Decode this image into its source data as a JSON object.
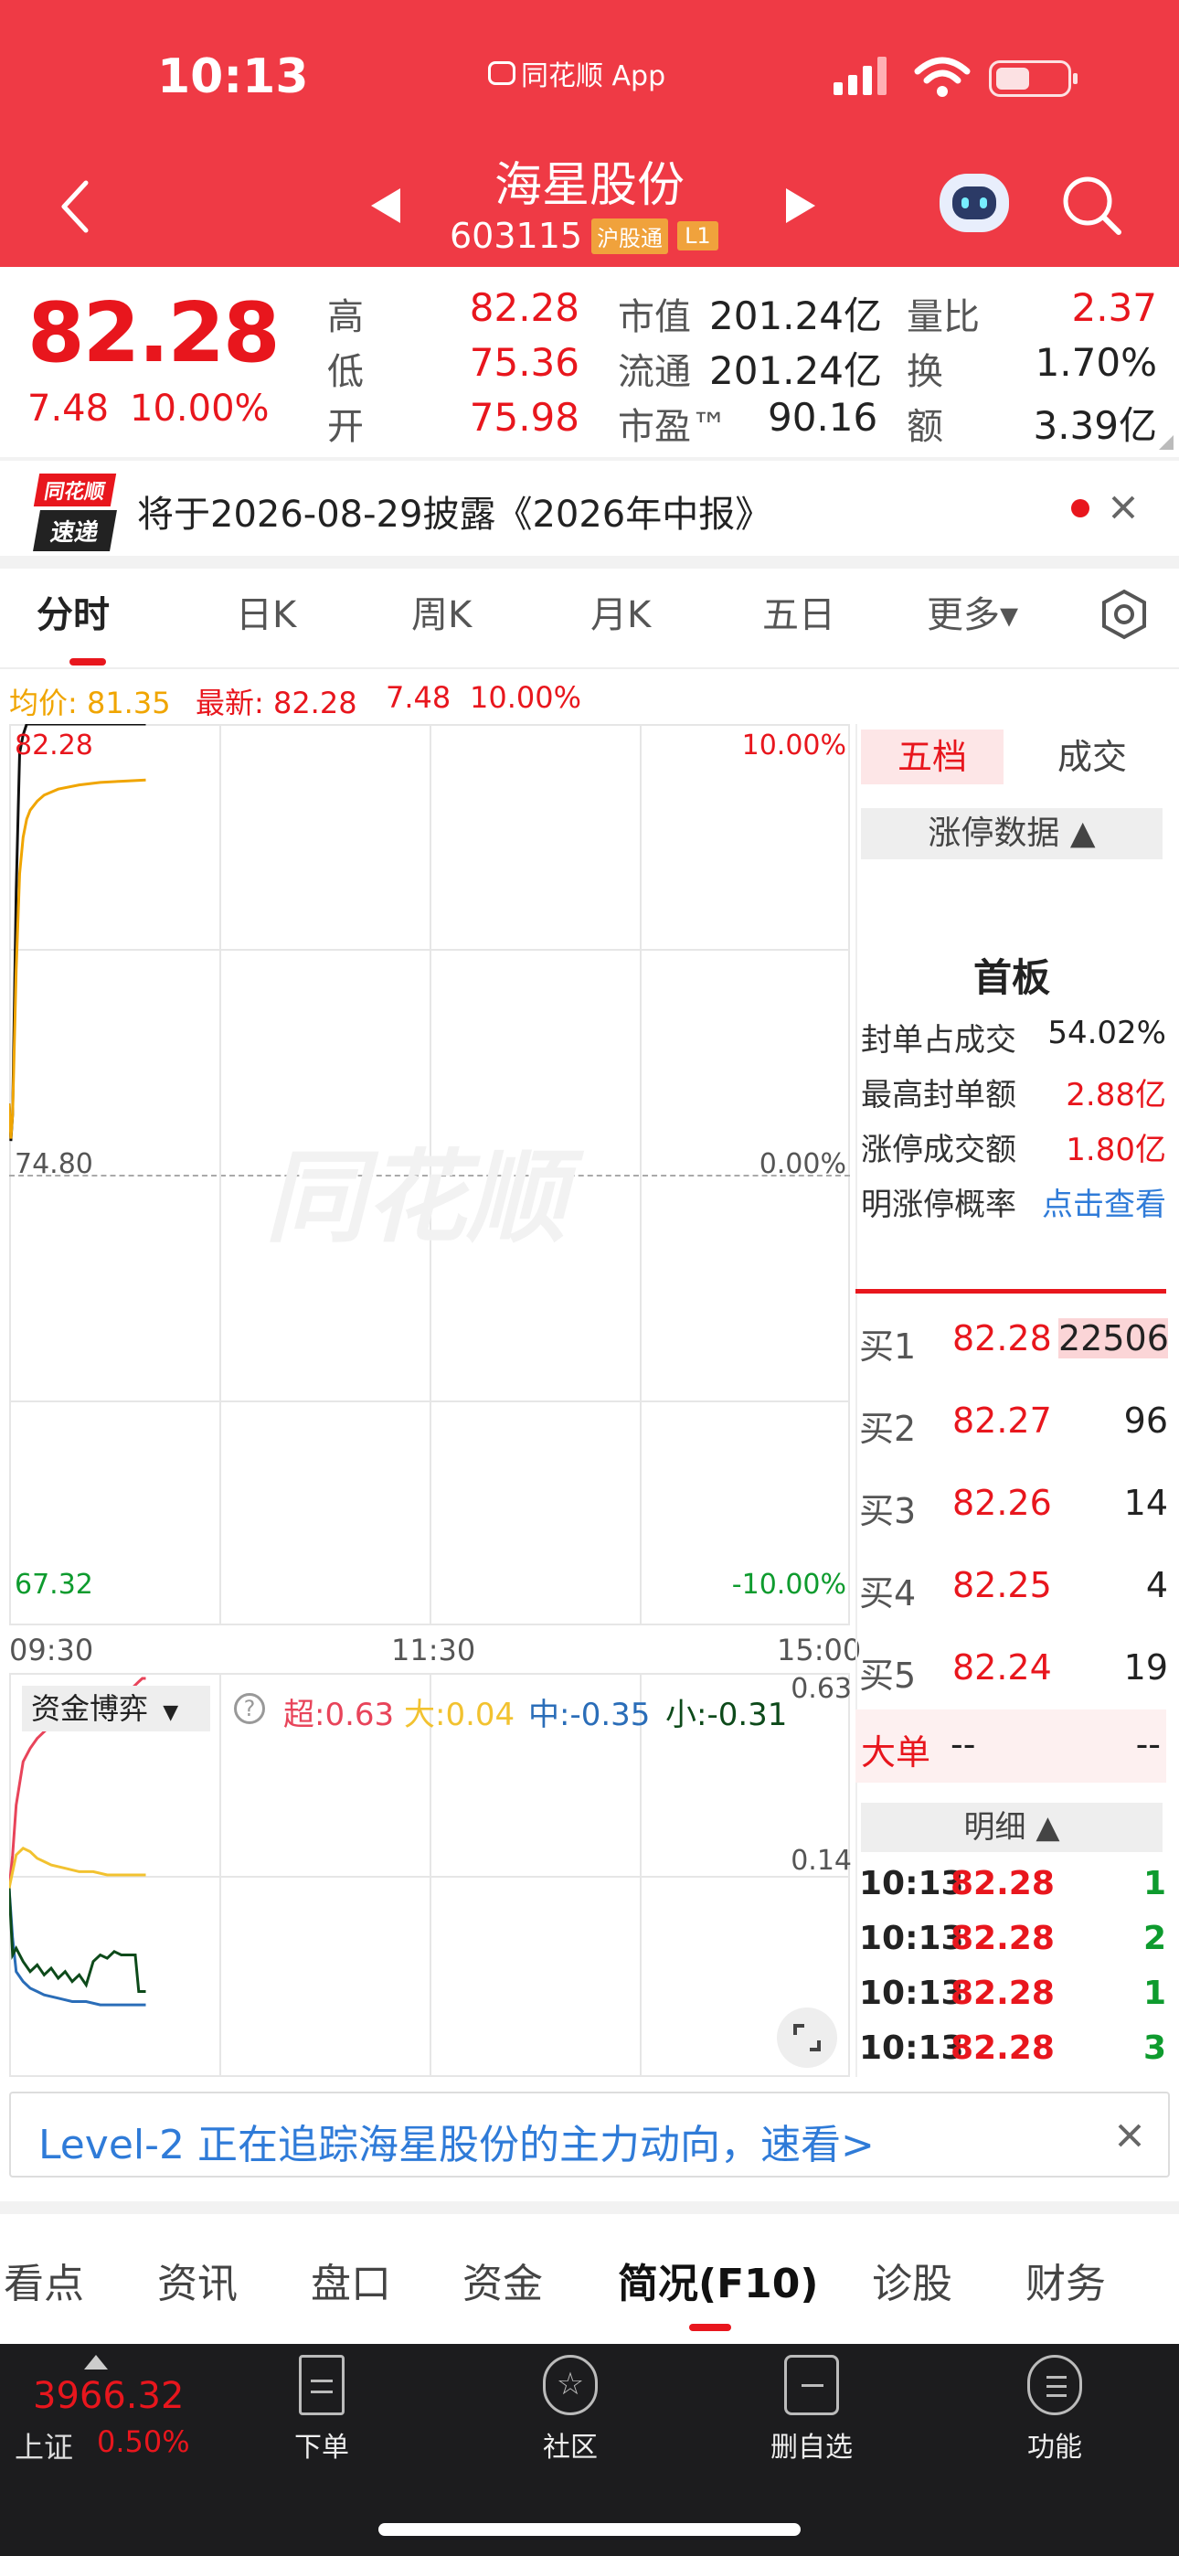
{
  "status": {
    "time": "10:13",
    "app_label": "同花顺 App"
  },
  "header": {
    "title": "海星股份",
    "code": "603115",
    "badge1": "沪股通",
    "badge2": "L1"
  },
  "quote": {
    "price": "82.28",
    "change": "7.48",
    "change_pct": "10.00%",
    "items": [
      {
        "label": "高",
        "value": "82.28"
      },
      {
        "label": "低",
        "value": "75.36"
      },
      {
        "label": "开",
        "value": "75.98"
      },
      {
        "label": "市值",
        "value": "201.24亿"
      },
      {
        "label": "流通",
        "value": "201.24亿"
      },
      {
        "label": "市盈™",
        "value": "90.16"
      },
      {
        "label": "量比",
        "value": "2.37"
      },
      {
        "label": "换",
        "value": "1.70%"
      },
      {
        "label": "额",
        "value": "3.39亿"
      }
    ]
  },
  "notice": {
    "logo_top": "同花顺",
    "logo_bottom": "速递",
    "text": "将于2026-08-29披露《2026年中报》"
  },
  "tabs": [
    "分时",
    "日K",
    "周K",
    "月K",
    "五日",
    "更多▾"
  ],
  "chart_info": {
    "avg_label": "均价: 81.35",
    "latest_label": "最新: 82.28",
    "change": "7.48",
    "pct": "10.00%"
  },
  "chart_data": {
    "type": "line",
    "y_left_ticks": [
      "82.28",
      "74.80",
      "67.32"
    ],
    "y_right_ticks": [
      "10.00%",
      "0.00%",
      "-10.00%"
    ],
    "x_ticks": [
      "09:30",
      "11:30",
      "15:00"
    ],
    "ylim": [
      67.32,
      82.28
    ],
    "series": [
      {
        "name": "最新",
        "color": "#111111",
        "x": [
          0,
          0.5,
          1,
          2,
          3,
          4,
          5,
          6,
          7,
          8,
          9,
          10,
          11,
          12,
          13,
          14,
          15,
          16,
          17,
          18,
          19,
          20,
          21,
          22,
          23,
          24,
          25,
          26,
          27,
          28,
          29,
          30,
          31,
          32,
          33,
          34,
          35,
          36,
          37,
          38,
          39
        ],
        "values": [
          75.98,
          75.36,
          75.8,
          79.5,
          81.8,
          82.1,
          82.28,
          82.28,
          82.28,
          82.28,
          82.28,
          82.28,
          82.28,
          82.28,
          82.28,
          82.28,
          82.28,
          82.28,
          82.28,
          82.28,
          82.28,
          82.28,
          82.28,
          82.28,
          82.28,
          82.28,
          82.28,
          82.28,
          82.28,
          82.28,
          82.28,
          82.28,
          82.28,
          82.28,
          82.28,
          82.28,
          82.28,
          82.28,
          82.28,
          82.28,
          82.28
        ]
      },
      {
        "name": "均价",
        "color": "#f0a500",
        "x": [
          0,
          0.5,
          1,
          2,
          3,
          4,
          5,
          6,
          8,
          10,
          14,
          20,
          26,
          32,
          39
        ],
        "values": [
          75.98,
          75.4,
          75.8,
          78.2,
          79.8,
          80.4,
          80.7,
          80.85,
          81.0,
          81.1,
          81.2,
          81.27,
          81.31,
          81.33,
          81.35
        ]
      }
    ],
    "flow": {
      "ylim": [
        -0.55,
        0.63
      ],
      "right_ticks": [
        "0.63",
        "0.14"
      ],
      "series": [
        {
          "name": "超",
          "color": "#e8445a",
          "x": [
            0,
            1,
            2,
            4,
            6,
            8,
            10,
            12,
            14,
            16,
            20,
            24,
            28,
            32,
            35,
            36,
            37,
            38,
            39
          ],
          "values": [
            0.0,
            0.1,
            0.25,
            0.38,
            0.42,
            0.45,
            0.47,
            0.49,
            0.5,
            0.52,
            0.54,
            0.55,
            0.57,
            0.58,
            0.6,
            0.61,
            0.62,
            0.63,
            0.63
          ]
        },
        {
          "name": "大",
          "color": "#f2c230",
          "x": [
            0,
            1,
            2,
            4,
            6,
            8,
            10,
            12,
            16,
            20,
            24,
            28,
            32,
            36,
            39
          ],
          "values": [
            0.0,
            0.05,
            0.1,
            0.12,
            0.11,
            0.09,
            0.08,
            0.07,
            0.06,
            0.05,
            0.05,
            0.04,
            0.04,
            0.04,
            0.04
          ]
        },
        {
          "name": "中",
          "color": "#2a6db8",
          "x": [
            0,
            1,
            2,
            4,
            6,
            8,
            10,
            14,
            18,
            22,
            26,
            30,
            34,
            39
          ],
          "values": [
            0.0,
            -0.15,
            -0.25,
            -0.28,
            -0.3,
            -0.31,
            -0.32,
            -0.33,
            -0.34,
            -0.34,
            -0.35,
            -0.35,
            -0.35,
            -0.35
          ]
        },
        {
          "name": "小",
          "color": "#0d4a1a",
          "x": [
            0,
            1,
            2,
            4,
            6,
            8,
            10,
            12,
            14,
            16,
            18,
            20,
            22,
            24,
            26,
            28,
            30,
            32,
            34,
            36,
            37,
            38,
            39
          ],
          "values": [
            0.0,
            -0.2,
            -0.18,
            -0.22,
            -0.25,
            -0.23,
            -0.26,
            -0.24,
            -0.27,
            -0.25,
            -0.28,
            -0.26,
            -0.29,
            -0.22,
            -0.2,
            -0.21,
            -0.19,
            -0.2,
            -0.2,
            -0.2,
            -0.31,
            -0.31,
            -0.31
          ]
        }
      ]
    }
  },
  "flow_panel": {
    "dropdown": "资金博弈",
    "chao": "超:0.63",
    "da": "大:0.04",
    "zhong": "中:-0.35",
    "xiao": "小:-0.31"
  },
  "side": {
    "tab_active": "五档",
    "tab_other": "成交",
    "limit_header": "涨停数据 ▲",
    "board": "首板",
    "stats": [
      {
        "label": "封单占成交",
        "value": "54.02%"
      },
      {
        "label": "最高封单额",
        "value": "2.88亿"
      },
      {
        "label": "涨停成交额",
        "value": "1.80亿"
      },
      {
        "label": "明涨停概率",
        "value": "点击查看"
      }
    ],
    "bids": [
      {
        "label": "买1",
        "price": "82.28",
        "vol": "22506"
      },
      {
        "label": "买2",
        "price": "82.27",
        "vol": "96"
      },
      {
        "label": "买3",
        "price": "82.26",
        "vol": "14"
      },
      {
        "label": "买4",
        "price": "82.25",
        "vol": "4"
      },
      {
        "label": "买5",
        "price": "82.24",
        "vol": "19"
      }
    ],
    "big_order": {
      "label": "大单",
      "v1": "--",
      "v2": "--"
    },
    "detail_header": "明细 ▲",
    "details": [
      {
        "t": "10:13",
        "p": "82.28",
        "v": "1"
      },
      {
        "t": "10:13",
        "p": "82.28",
        "v": "2"
      },
      {
        "t": "10:13",
        "p": "82.28",
        "v": "1"
      },
      {
        "t": "10:13",
        "p": "82.28",
        "v": "3"
      }
    ]
  },
  "banner": {
    "text": "Level-2 正在追踪海星股份的主力动向，速看>"
  },
  "bottom_tabs": [
    "看点",
    "资讯",
    "盘口",
    "资金",
    "简况(F10)",
    "诊股",
    "财务"
  ],
  "nav": {
    "index_value": "3966.32",
    "index_name": "上证",
    "index_pct": "0.50%",
    "buttons": [
      "下单",
      "社区",
      "删自选",
      "功能"
    ]
  },
  "watermark": "同花顺"
}
